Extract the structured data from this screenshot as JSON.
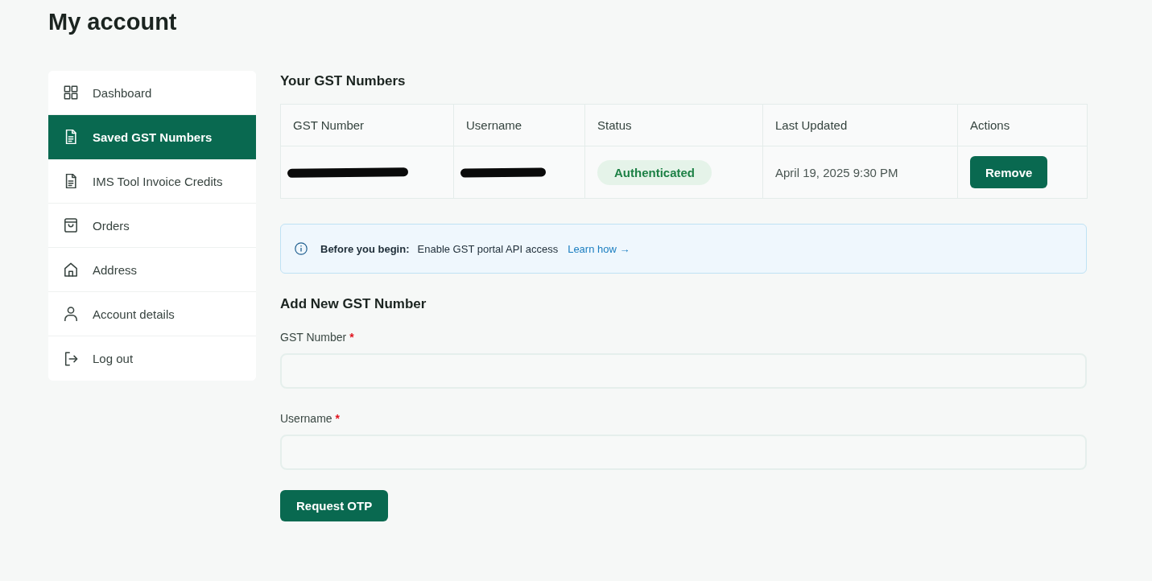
{
  "page": {
    "title": "My account"
  },
  "sidebar": {
    "items": [
      {
        "label": "Dashboard",
        "selected": false
      },
      {
        "label": "Saved GST Numbers",
        "selected": true
      },
      {
        "label": "IMS Tool Invoice Credits",
        "selected": false
      },
      {
        "label": "Orders",
        "selected": false
      },
      {
        "label": "Address",
        "selected": false
      },
      {
        "label": "Account details",
        "selected": false
      },
      {
        "label": "Log out",
        "selected": false
      }
    ]
  },
  "gst_numbers": {
    "title": "Your GST Numbers",
    "table": {
      "columns": [
        "GST Number",
        "Username",
        "Status",
        "Last Updated",
        "Actions"
      ],
      "rows": [
        {
          "cells": [
            {
              "kind": "redacted"
            },
            {
              "kind": "redacted"
            },
            {
              "kind": "badge",
              "text": "Authenticated"
            },
            {
              "kind": "text",
              "text": "April 19, 2025 9:30 PM"
            },
            {
              "kind": "button",
              "text": "Remove"
            }
          ]
        }
      ]
    }
  },
  "notice": {
    "lead": "Before you begin:",
    "text": "Enable GST portal API access",
    "link": "Learn how →"
  },
  "add_form": {
    "title": "Add New GST Number",
    "fields": [
      {
        "label": "GST Number",
        "required_mark": "*"
      },
      {
        "label": "Username",
        "required_mark": "*"
      }
    ],
    "submit": "Request OTP"
  }
}
